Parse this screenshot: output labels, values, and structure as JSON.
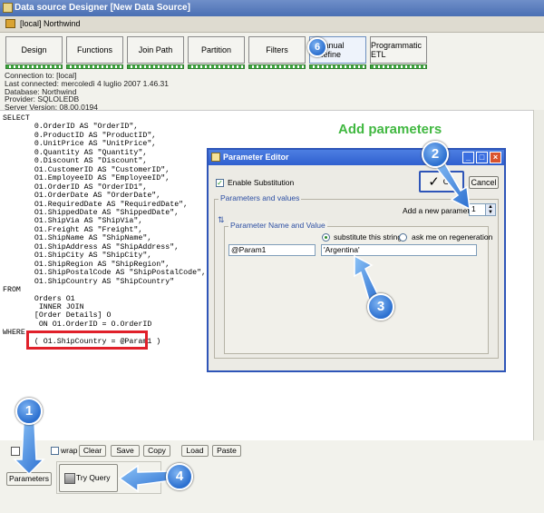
{
  "window": {
    "title": "Data source Designer [New Data Source]"
  },
  "source": {
    "label": "[local] Northwind"
  },
  "tabs": [
    "Design",
    "Functions",
    "Join Path",
    "Partition",
    "Filters",
    "Manual Refine",
    "Programmatic ETL"
  ],
  "connection": [
    "Connection to: [local]",
    "Last connected: mercoledì 4 luglio 2007 1.46.31",
    "Database: Northwind",
    "Provider: SQLOLEDB",
    "Server Version: 08.00.0194"
  ],
  "sql_lines": [
    "SELECT",
    "       0.OrderID AS \"OrderID\",",
    "       0.ProductID AS \"ProductID\",",
    "       0.UnitPrice AS \"UnitPrice\",",
    "       0.Quantity AS \"Quantity\",",
    "       0.Discount AS \"Discount\",",
    "       O1.CustomerID AS \"CustomerID\",",
    "       O1.EmployeeID AS \"EmployeeID\",",
    "       O1.OrderID AS \"OrderID1\",",
    "       O1.OrderDate AS \"OrderDate\",",
    "       O1.RequiredDate AS \"RequiredDate\",",
    "       O1.ShippedDate AS \"ShippedDate\",",
    "       O1.ShipVia AS \"ShipVia\",",
    "       O1.Freight AS \"Freight\",",
    "       O1.ShipName AS \"ShipName\",",
    "       O1.ShipAddress AS \"ShipAddress\",",
    "       O1.ShipCity AS \"ShipCity\",",
    "       O1.ShipRegion AS \"ShipRegion\",",
    "       O1.ShipPostalCode AS \"ShipPostalCode\",",
    "       O1.ShipCountry AS \"ShipCountry\"",
    "FROM",
    "       Orders O1",
    "        INNER JOIN",
    "       [Order Details] O",
    "        ON O1.OrderID = O.OrderID",
    "WHERE",
    "       ( O1.ShipCountry = @Param1 )"
  ],
  "heading": "Add parameters",
  "dialog": {
    "title": "Parameter Editor",
    "enable_substitution": "Enable Substitution",
    "ok_label": "OK",
    "cancel_label": "Cancel",
    "params_group": "Parameters and values",
    "add_param_label": "Add a new parameter:",
    "add_param_value": "1",
    "name_value_group": "Parameter Name and Value",
    "substitute_label": "substitute this string:",
    "ask_label": "ask me on regeneration",
    "param_name": "@Param1",
    "param_value": "'Argentina'"
  },
  "toolbar": {
    "wrap_label": "wrap",
    "clear_label": "Clear",
    "save_label": "Save",
    "copy_label": "Copy",
    "load_label": "Load",
    "paste_label": "Paste",
    "parameters_label": "Parameters",
    "try_query_label": "Try Query"
  },
  "callouts": [
    "1",
    "2",
    "3",
    "4",
    "6"
  ],
  "colors": {
    "titlebar": "#4a6fb3",
    "accent_green": "#41b841",
    "highlight_red": "#e0202a",
    "callout_blue": "#2b6fcf",
    "dialog_border": "#2e55b8"
  }
}
